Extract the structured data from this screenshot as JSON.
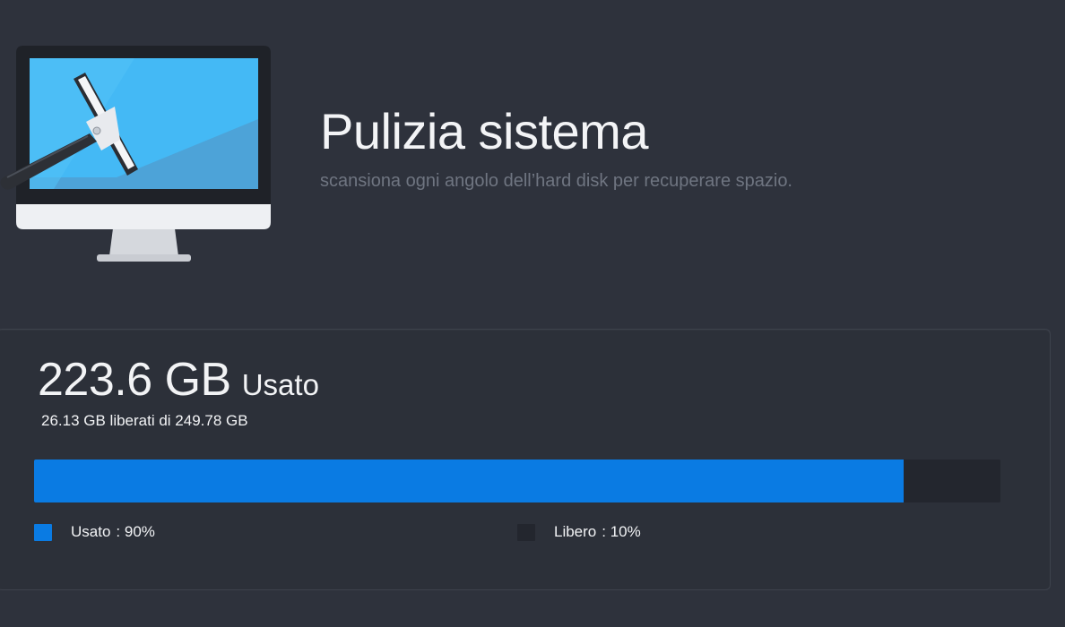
{
  "header": {
    "title": "Pulizia sistema",
    "subtitle": "scansiona ogni angolo dell’hard disk per recuperare spazio.",
    "icon": "monitor-squeegee-icon"
  },
  "disk": {
    "used_value": "223.6 GB",
    "used_label": "Usato",
    "freed_summary": "26.13 GB liberati di 249.78 GB",
    "used_fraction": 0.9,
    "legend": {
      "used": {
        "label": "Usato",
        "value": ": 90%",
        "color": "#0a7be3"
      },
      "free": {
        "label": "Libero",
        "value": ": 10%",
        "color": "#23262e"
      }
    }
  }
}
